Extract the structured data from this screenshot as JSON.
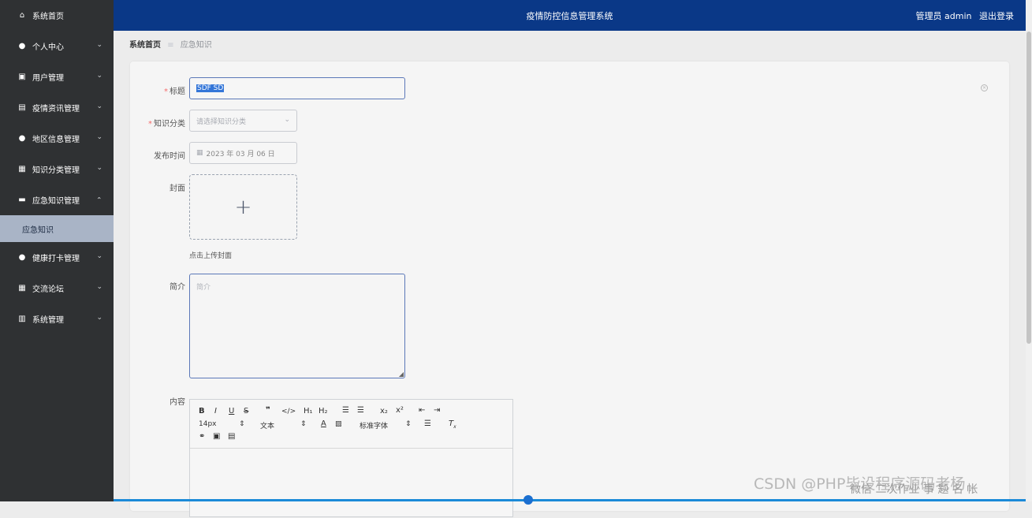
{
  "app": {
    "title": "疫情防控信息管理系统",
    "user": "管理员 admin",
    "logout": "退出登录"
  },
  "sidebar": {
    "items": [
      {
        "label": "系统首页",
        "icon": "home-icon",
        "glyph": "⌂",
        "hasArrow": false
      },
      {
        "label": "个人中心",
        "icon": "user-icon",
        "glyph": "●",
        "hasArrow": true
      },
      {
        "label": "用户管理",
        "icon": "clipboard-icon",
        "glyph": "▣",
        "hasArrow": true
      },
      {
        "label": "疫情资讯管理",
        "icon": "news-icon",
        "glyph": "▤",
        "hasArrow": true
      },
      {
        "label": "地区信息管理",
        "icon": "user-icon",
        "glyph": "●",
        "hasArrow": true
      },
      {
        "label": "知识分类管理",
        "icon": "grid-icon",
        "glyph": "▦",
        "hasArrow": true
      },
      {
        "label": "应急知识管理",
        "icon": "folder-icon",
        "glyph": "▬",
        "hasArrow": true,
        "open": true
      },
      {
        "sub": "应急知识"
      },
      {
        "label": "健康打卡管理",
        "icon": "location-icon",
        "glyph": "●",
        "hasArrow": true
      },
      {
        "label": "交流论坛",
        "icon": "grid-icon",
        "glyph": "▦",
        "hasArrow": true
      },
      {
        "label": "系统管理",
        "icon": "chart-icon",
        "glyph": "▥",
        "hasArrow": true
      }
    ]
  },
  "breadcrumb": {
    "home": "系统首页",
    "separator": "≡",
    "current": "应急知识"
  },
  "form": {
    "title_label": "标题",
    "title_value": "SDF SD",
    "category_label": "知识分类",
    "category_placeholder": "请选择知识分类",
    "date_label": "发布时间",
    "date_value": "2023 年 03 月 06 日",
    "cover_label": "封面",
    "cover_hint": "点击上传封面",
    "intro_label": "简介",
    "intro_placeholder": "简介",
    "content_label": "内容"
  },
  "editor": {
    "font_size": "14px",
    "text_style": "文本",
    "font_family": "标准字体"
  },
  "watermark": {
    "text": "CSDN @PHP毕设程序源码老杨",
    "text2": "微信 二次作业 事 题 名 帐"
  },
  "colors": {
    "sidebar_bg": "#2f3133",
    "topbar_bg": "#0a3887",
    "submenu_bg": "#a9b4c6",
    "required": "#f56c6c",
    "focus_border": "#5b78b8"
  }
}
